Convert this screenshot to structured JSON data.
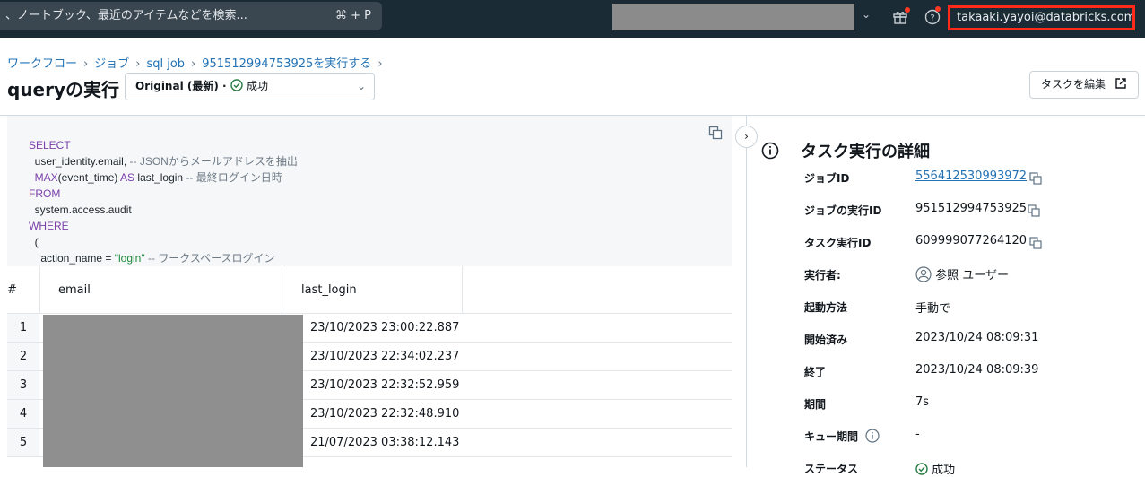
{
  "topbar": {
    "search_placeholder": "、ノートブック、最近のアイテムなどを検索...",
    "search_shortcut": "⌘ + P",
    "user_email": "takaaki.yayoi@databricks.com",
    "icons": [
      "chevron-down-icon",
      "gift-icon",
      "help-icon"
    ]
  },
  "breadcrumb": {
    "items": [
      "ワークフロー",
      "ジョブ",
      "sql job",
      "951512994753925を実行する"
    ]
  },
  "header": {
    "title": "queryの実行",
    "run_selector": {
      "label": "Original (最新) ·",
      "status": "成功"
    },
    "edit_button": "タスクを編集"
  },
  "code": {
    "lines": [
      [
        "SELECT"
      ],
      [
        "  user_identity.email, ",
        "-- JSONからメールアドレスを抽出"
      ],
      [
        "  MAX",
        "(event_time) ",
        "AS",
        " last_login ",
        "-- 最終ログイン日時"
      ],
      [
        "FROM"
      ],
      [
        "  system.access.audit"
      ],
      [
        "WHERE"
      ],
      [
        "  ("
      ],
      [
        "    action_name = ",
        "\"login\"",
        " -- ワークスペースログイン"
      ]
    ]
  },
  "results": {
    "columns": [
      "#",
      "email",
      "last_login"
    ],
    "rows": [
      {
        "n": "1",
        "last_login": "23/10/2023 23:00:22.887"
      },
      {
        "n": "2",
        "last_login": "23/10/2023 22:34:02.237"
      },
      {
        "n": "3",
        "last_login": "23/10/2023 22:32:52.959"
      },
      {
        "n": "4",
        "last_login": "23/10/2023 22:32:48.910"
      },
      {
        "n": "5",
        "last_login": "21/07/2023 03:38:12.143"
      }
    ]
  },
  "details": {
    "title": "タスク実行の詳細",
    "rows": [
      {
        "label": "ジョブID",
        "value": "556412530993972"
      },
      {
        "label": "ジョブの実行ID",
        "value": "951512994753925"
      },
      {
        "label": "タスク実行ID",
        "value": "609999077264120"
      },
      {
        "label": "実行者:",
        "value": "参照 ユーザー"
      },
      {
        "label": "起動方法",
        "value": "手動で"
      },
      {
        "label": "開始済み",
        "value": "2023/10/24 08:09:31"
      },
      {
        "label": "終了",
        "value": "2023/10/24 08:09:39"
      },
      {
        "label": "期間",
        "value": "7s"
      },
      {
        "label": "キュー期間",
        "value": "-"
      },
      {
        "label": "ステータス",
        "value": "成功"
      }
    ]
  },
  "colors": {
    "topbar": "#1b2b36",
    "link": "#2272b4",
    "success": "#277c43",
    "highlight": "#ff2a1a"
  }
}
